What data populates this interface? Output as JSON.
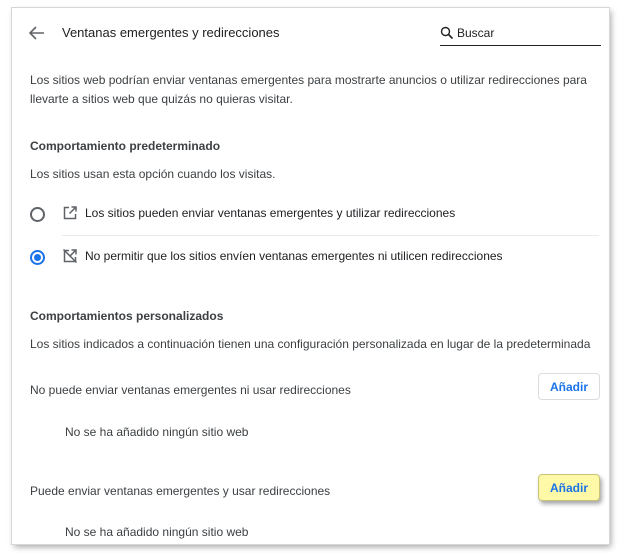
{
  "header": {
    "title": "Ventanas emergentes y redirecciones",
    "search_placeholder": "Buscar"
  },
  "intro": {
    "line1": "Los sitios web podrían enviar ventanas emergentes para mostrarte anuncios o utilizar redirecciones para",
    "line2": "llevarte a sitios web que quizás no quieras visitar."
  },
  "default_behavior": {
    "title": "Comportamiento predeterminado",
    "subtitle": "Los sitios usan esta opción cuando los visitas.",
    "options": [
      {
        "label": "Los sitios pueden enviar ventanas emergentes y utilizar redirecciones",
        "icon": "open-in-new-icon",
        "selected": false
      },
      {
        "label": "No permitir que los sitios envíen ventanas emergentes ni utilicen redirecciones",
        "icon": "popups-blocked-icon",
        "selected": true
      }
    ]
  },
  "custom_behaviors": {
    "title": "Comportamientos personalizados",
    "subtitle": "Los sitios indicados a continuación tienen una configuración personalizada en lugar de la predeterminada",
    "block_list": {
      "label": "No puede enviar ventanas emergentes ni usar redirecciones",
      "add_label": "Añadir",
      "empty_text": "No se ha añadido ningún sitio web"
    },
    "allow_list": {
      "label": "Puede enviar ventanas emergentes y usar redirecciones",
      "add_label": "Añadir",
      "empty_text": "No se ha añadido ningún sitio web"
    }
  },
  "colors": {
    "accent": "#1a73e8",
    "highlight": "#fdf9a6"
  }
}
